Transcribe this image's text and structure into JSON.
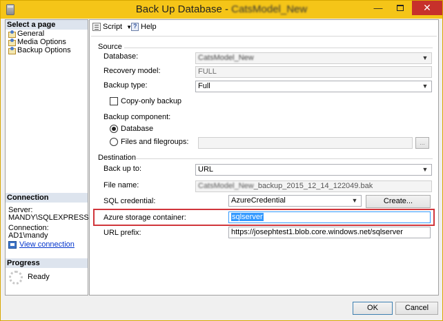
{
  "window": {
    "title_prefix": "Back Up Database - ",
    "title_db": "CatsModel_New",
    "minimize": "—",
    "close": "✕"
  },
  "left": {
    "select_page_header": "Select a page",
    "pages": [
      "General",
      "Media Options",
      "Backup Options"
    ],
    "connection_header": "Connection",
    "server_label": "Server:",
    "server_value": "MANDY\\SQLEXPRESS",
    "connection_label": "Connection:",
    "connection_value": "AD1\\mandy",
    "view_connection": "View connection",
    "progress_header": "Progress",
    "progress_status": "Ready"
  },
  "toolbar": {
    "script_label": "Script",
    "script_arrow": "▼",
    "help_label": "Help"
  },
  "source": {
    "group": "Source",
    "database_label": "Database:",
    "database_value": "CatsModel_New",
    "recovery_label": "Recovery model:",
    "recovery_value": "FULL",
    "backup_type_label": "Backup type:",
    "backup_type_value": "Full",
    "copy_only_label": "Copy-only backup",
    "copy_only_checked": false,
    "component_label": "Backup component:",
    "component_database": "Database",
    "component_files": "Files and filegroups:",
    "component_selected": "Database",
    "browse_label": "..."
  },
  "destination": {
    "group": "Destination",
    "backup_to_label": "Back up to:",
    "backup_to_value": "URL",
    "file_name_label": "File name:",
    "file_name_blurred": "CatsModel_New",
    "file_name_suffix": "_backup_2015_12_14_122049.bak",
    "sql_credential_label": "SQL credential:",
    "sql_credential_value": "AzureCredential",
    "create_label": "Create...",
    "container_label": "Azure storage container:",
    "container_value": "sqlserver",
    "url_prefix_label": "URL prefix:",
    "url_prefix_value": "https://josephtest1.blob.core.windows.net/sqlserver"
  },
  "footer": {
    "ok": "OK",
    "cancel": "Cancel"
  },
  "colors": {
    "titlebar": "#f5c518",
    "close_button": "#c7312b",
    "highlight_box": "#d0343a",
    "selection": "#3399ff",
    "link": "#0033cc"
  }
}
